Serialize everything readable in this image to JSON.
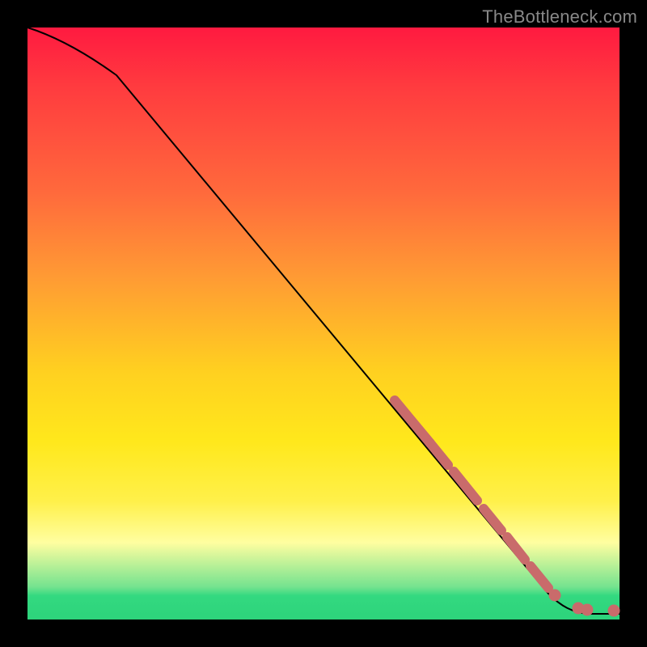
{
  "watermark": "TheBottleneck.com",
  "colors": {
    "frame": "#000000",
    "gradient_top": "#ff1a40",
    "gradient_mid": "#ffe81c",
    "gradient_green": "#33d980",
    "curve": "#000000",
    "dot": "#c96b6b"
  },
  "chart_data": {
    "type": "line",
    "title": "",
    "xlabel": "",
    "ylabel": "",
    "xlim": [
      0,
      100
    ],
    "ylim": [
      0,
      100
    ],
    "series": [
      {
        "name": "curve",
        "x": [
          0,
          3,
          8,
          15,
          25,
          35,
          45,
          55,
          62,
          70,
          78,
          85,
          88,
          92,
          96,
          100
        ],
        "y": [
          100,
          99,
          97,
          92,
          81,
          69,
          57,
          45,
          37,
          27,
          17,
          8,
          5,
          2,
          1,
          1
        ]
      }
    ],
    "scatter_points": {
      "name": "dots",
      "x": [
        62,
        63,
        64,
        65,
        66,
        68,
        69,
        70,
        71,
        73,
        74,
        76,
        78,
        79,
        81,
        82,
        84,
        86,
        88,
        90,
        93,
        96,
        99
      ],
      "y": [
        37,
        36,
        35,
        33,
        32,
        30,
        29,
        27,
        26,
        24,
        23,
        20,
        17,
        16,
        13,
        12,
        10,
        7,
        5,
        3,
        1,
        1,
        1
      ]
    }
  }
}
